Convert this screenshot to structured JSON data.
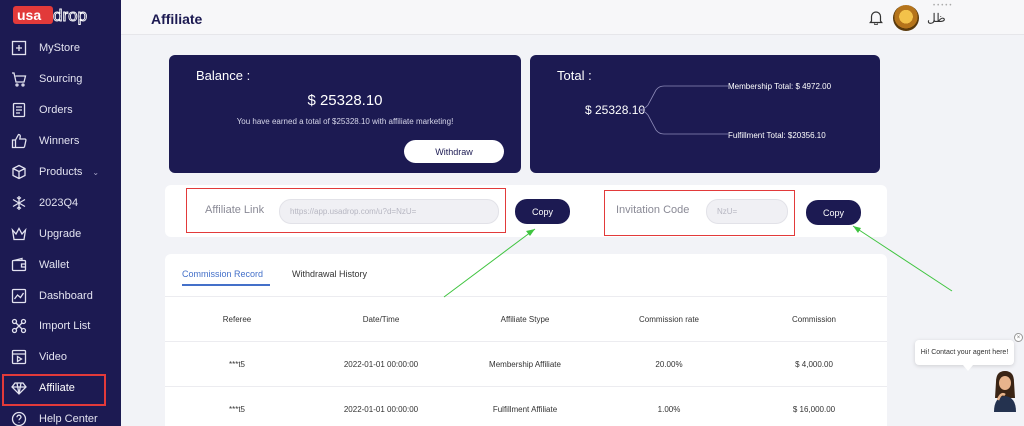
{
  "brand": {
    "logo_text": "USAdrop",
    "accent": "#1c1a52",
    "highlight": "#e23a3a"
  },
  "header": {
    "title": "Affiliate",
    "username": "ظل"
  },
  "sidebar": {
    "items": [
      {
        "label": "MyStore",
        "icon": "store-plus-icon"
      },
      {
        "label": "Sourcing",
        "icon": "cart-icon"
      },
      {
        "label": "Orders",
        "icon": "orders-icon"
      },
      {
        "label": "Winners",
        "icon": "thumbs-up-icon"
      },
      {
        "label": "Products",
        "icon": "box-icon",
        "chevron": "⌄"
      },
      {
        "label": "2023Q4",
        "icon": "snowflake-icon"
      },
      {
        "label": "Upgrade",
        "icon": "crown-icon"
      },
      {
        "label": "Wallet",
        "icon": "wallet-icon"
      },
      {
        "label": "Dashboard",
        "icon": "chart-icon"
      },
      {
        "label": "Import List",
        "icon": "import-icon"
      },
      {
        "label": "Video",
        "icon": "video-icon"
      },
      {
        "label": "Affiliate",
        "icon": "diamond-icon",
        "active": true
      },
      {
        "label": "Help Center",
        "icon": "question-icon"
      }
    ]
  },
  "balance": {
    "label": "Balance :",
    "amount": "$ 25328.10",
    "note": "You have earned a total of $25328.10 with affiliate marketing!",
    "withdraw_label": "Withdraw"
  },
  "total": {
    "label": "Total :",
    "amount": "$ 25328.10",
    "membership": "Membership Total: $ 4972.00",
    "fulfillment": "Fulfillment Total: $20356.10"
  },
  "affiliate_link": {
    "label": "Affiliate Link",
    "placeholder": "https://app.usadrop.com/u?d=NzU=",
    "copy_label": "Copy"
  },
  "invitation_code": {
    "label": "Invitation Code",
    "placeholder": "NzU=",
    "copy_label": "Copy"
  },
  "tabs": [
    {
      "label": "Commission Record",
      "active": true
    },
    {
      "label": "Withdrawal History",
      "active": false
    }
  ],
  "table": {
    "columns": [
      "Referee",
      "Date/Time",
      "Affiliate Stype",
      "Commission rate",
      "Commission"
    ],
    "rows": [
      [
        "***t5",
        "2022-01-01 00:00:00",
        "Membership Affiliate",
        "20.00%",
        "$ 4,000.00"
      ],
      [
        "***t5",
        "2022-01-01 00:00:00",
        "Fulfillment Affiliate",
        "1.00%",
        "$ 16,000.00"
      ]
    ]
  },
  "chat": {
    "message": "Hi! Contact your agent here!",
    "close": "×"
  }
}
